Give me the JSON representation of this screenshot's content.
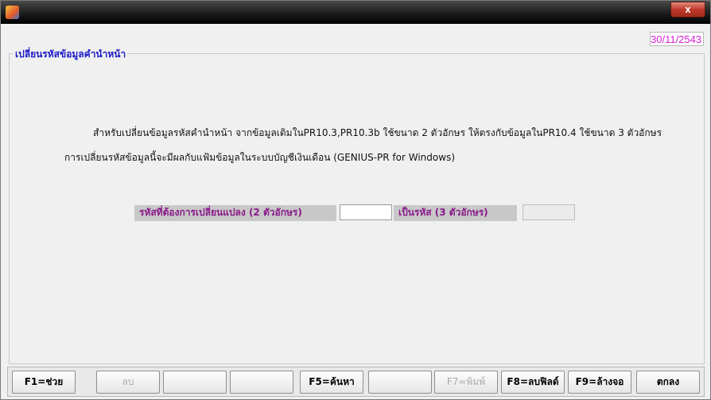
{
  "window": {
    "close_label": "x"
  },
  "date": "30/11/2543",
  "group": {
    "title": "เปลี่ยนรหัสข้อมูลคำนำหน้า"
  },
  "description": {
    "line1": "สำหรับเปลี่ยนข้อมูลรหัสคำนำหน้า จากข้อมูลเดิมในPR10.3,PR10.3b ใช้ขนาด 2 ตัวอักษร ให้ตรงกับข้อมูลในPR10.4 ใช้ขนาด 3 ตัวอักษร",
    "line2": "การเปลี่ยนรหัสข้อมูลนี้จะมีผลกับแฟ้มข้อมูลในระบบบัญชีเงินเดือน (GENIUS-PR for Windows)"
  },
  "form": {
    "old_code_label": "รหัสที่ต้องการเปลี่ยนแปลง (2 ตัวอักษร)",
    "old_code_value": "",
    "new_code_label": "เป็นรหัส (3 ตัวอักษร)",
    "new_code_value": ""
  },
  "toolbar": {
    "help": "F1=ช่วย",
    "delete": "ลบ",
    "blank1": "",
    "blank2": "",
    "search": "F5=ค้นหา",
    "blank3": "",
    "print": "F7=พิมพ์",
    "delete_field": "F8=ลบฟิลด์",
    "clear_screen": "F9=ล้างจอ",
    "ok": "ตกลง"
  }
}
